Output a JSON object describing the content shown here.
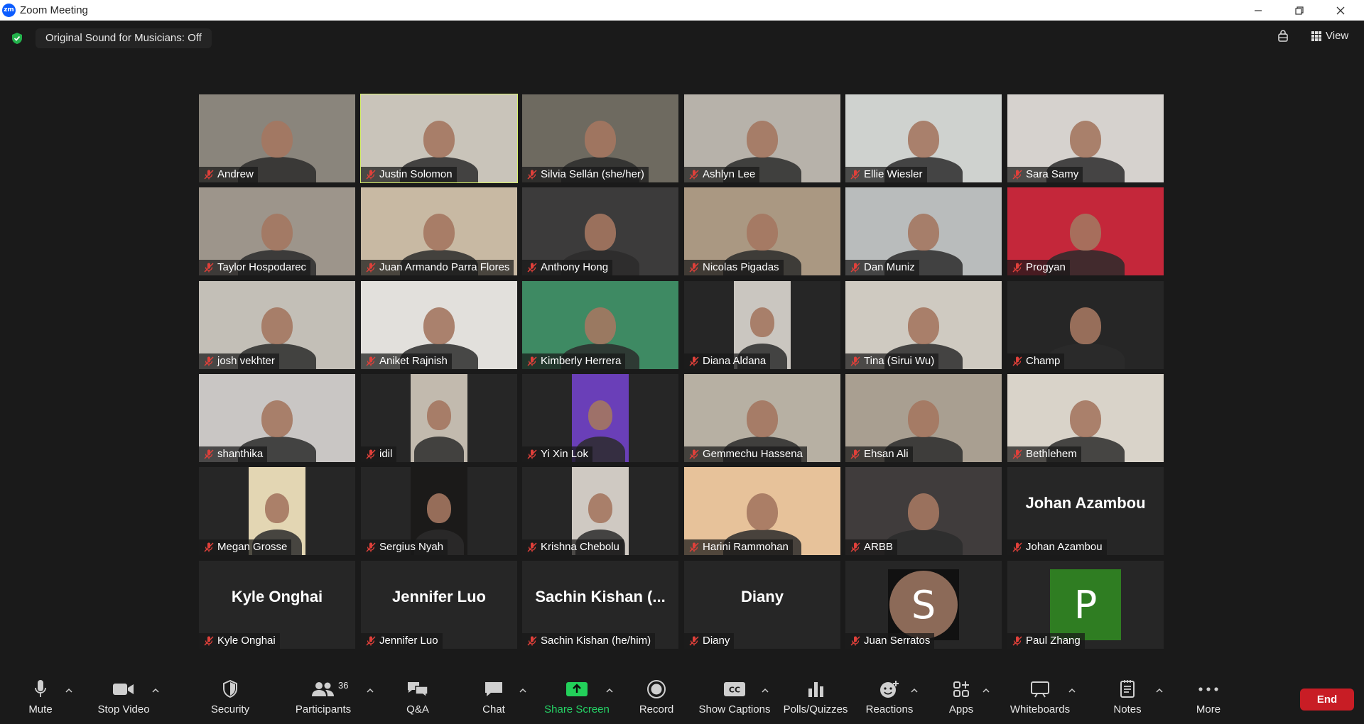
{
  "window": {
    "title": "Zoom Meeting",
    "logo_text": "zm"
  },
  "topbar": {
    "sound_label": "Original Sound for Musicians: Off",
    "view_label": "View"
  },
  "tiles": [
    {
      "name": "Andrew",
      "mode": "video",
      "bg": "#8a857c"
    },
    {
      "name": "Justin Solomon",
      "mode": "video",
      "bg": "#c9c4ba",
      "active": true
    },
    {
      "name": "Silvia Sellán (she/her)",
      "mode": "video",
      "bg": "#6e6a60"
    },
    {
      "name": "Ashlyn Lee",
      "mode": "video",
      "bg": "#b7b2aa"
    },
    {
      "name": "Ellie Wiesler",
      "mode": "video",
      "bg": "#cfd2cf"
    },
    {
      "name": "Sara Samy",
      "mode": "video",
      "bg": "#d6d2ce"
    },
    {
      "name": "Taylor Hospodarec",
      "mode": "video",
      "bg": "#9d958b"
    },
    {
      "name": "Juan Armando Parra Flores",
      "mode": "video",
      "bg": "#c8b9a3"
    },
    {
      "name": "Anthony Hong",
      "mode": "video",
      "bg": "#3c3b3b"
    },
    {
      "name": "Nicolas Pigadas",
      "mode": "video",
      "bg": "#aa9882"
    },
    {
      "name": "Dan Muniz",
      "mode": "video",
      "bg": "#b9bcbc"
    },
    {
      "name": "Progyan",
      "mode": "video",
      "bg": "#c4273a"
    },
    {
      "name": "josh vekhter",
      "mode": "video",
      "bg": "#c3bfb7"
    },
    {
      "name": "Aniket Rajnish",
      "mode": "video",
      "bg": "#e2e0dc"
    },
    {
      "name": "Kimberly Herrera",
      "mode": "video",
      "bg": "#3e8a63"
    },
    {
      "name": "Diana Aldana",
      "mode": "pillar",
      "bg": "#cac6c0"
    },
    {
      "name": "Tina (Sirui Wu)",
      "mode": "video",
      "bg": "#cfcac1"
    },
    {
      "name": "Champ",
      "mode": "video",
      "bg": "#262626"
    },
    {
      "name": "shanthika",
      "mode": "video",
      "bg": "#c9c6c4"
    },
    {
      "name": "idil",
      "mode": "pillar",
      "bg": "#c2baae"
    },
    {
      "name": "Yi Xin Lok",
      "mode": "pillar",
      "bg": "#6a3fb8"
    },
    {
      "name": "Gemmechu Hassena",
      "mode": "video",
      "bg": "#b7b0a3"
    },
    {
      "name": "Ehsan Ali",
      "mode": "video",
      "bg": "#a99f91"
    },
    {
      "name": "Bethlehem",
      "mode": "video",
      "bg": "#d9d3c9"
    },
    {
      "name": "Megan Grosse",
      "mode": "pillar",
      "bg": "#e3d6b3"
    },
    {
      "name": "Sergius Nyah",
      "mode": "pillar",
      "bg": "#1b1a19"
    },
    {
      "name": "Krishna Chebolu",
      "mode": "pillar",
      "bg": "#cfc9c2"
    },
    {
      "name": "Harini Rammohan",
      "mode": "video",
      "bg": "#e7c29a"
    },
    {
      "name": "ARBB",
      "mode": "video",
      "bg": "#403c3c"
    },
    {
      "name": "Johan Azambou",
      "mode": "name",
      "display": "Johan Azambou"
    },
    {
      "name": "Kyle Onghai",
      "mode": "name",
      "display": "Kyle Onghai"
    },
    {
      "name": "Jennifer Luo",
      "mode": "name",
      "display": "Jennifer Luo"
    },
    {
      "name": "Sachin Kishan (he/him)",
      "mode": "name",
      "display": "Sachin  Kishan  (..."
    },
    {
      "name": "Diany",
      "mode": "name",
      "display": "Diany"
    },
    {
      "name": "Juan Serratos",
      "mode": "avatar",
      "letter": "S",
      "color": "#8c6a58",
      "shape": "circle"
    },
    {
      "name": "Paul Zhang",
      "mode": "avatar",
      "letter": "P",
      "color": "#2f7d22",
      "shape": "square"
    }
  ],
  "toolbar": {
    "mute": "Mute",
    "stop_video": "Stop Video",
    "security": "Security",
    "participants": "Participants",
    "participant_count": "36",
    "qa": "Q&A",
    "chat": "Chat",
    "share_screen": "Share Screen",
    "record": "Record",
    "show_captions": "Show Captions",
    "polls": "Polls/Quizzes",
    "reactions": "Reactions",
    "apps": "Apps",
    "whiteboards": "Whiteboards",
    "notes": "Notes",
    "more": "More",
    "end": "End"
  },
  "colors": {
    "accent_green": "#25d366",
    "end_red": "#c81d25",
    "active_speaker": "#d7f16b",
    "muted_red": "#e0403a"
  }
}
